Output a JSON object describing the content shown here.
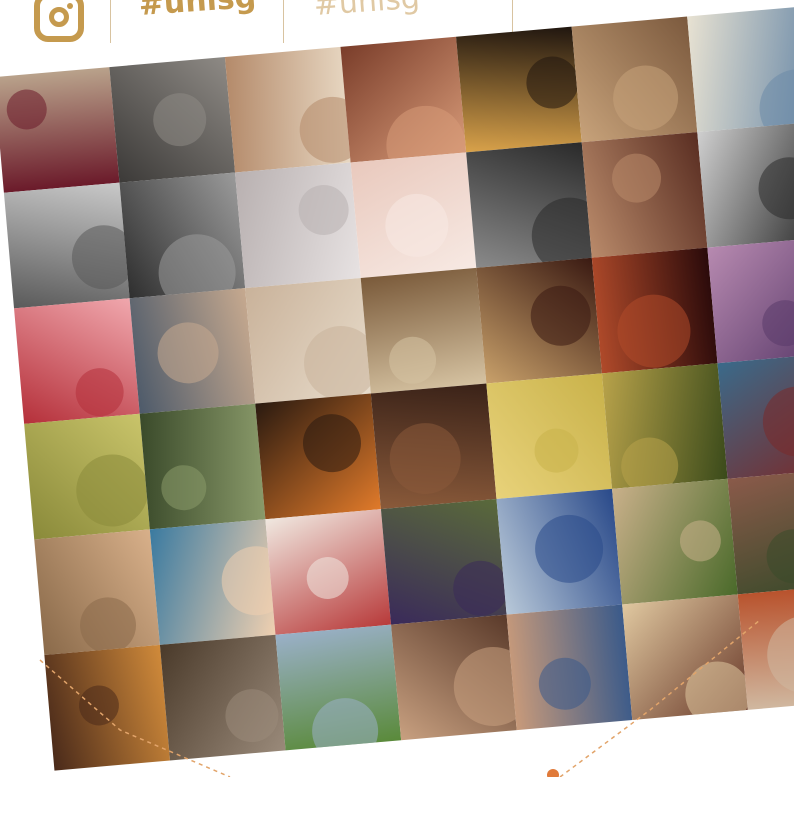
{
  "header": {
    "icon": "instagram-icon",
    "hashtag_primary": "#unisg",
    "hashtag_secondary": "#unisg",
    "accent_color": "#c59a4e"
  },
  "photos": [
    {
      "c1": "#6b1a2a",
      "c2": "#b9a28b"
    },
    {
      "c1": "#3c3a38",
      "c2": "#8e8a85"
    },
    {
      "c1": "#b48a6a",
      "c2": "#e8d8c3"
    },
    {
      "c1": "#7a3d2a",
      "c2": "#d79a78"
    },
    {
      "c1": "#20160f",
      "c2": "#d9a24a"
    },
    {
      "c1": "#7c5a3e",
      "c2": "#c7a27a"
    },
    {
      "c1": "#6b8aa8",
      "c2": "#e8e2d2"
    },
    {
      "c1": "#8a8a8a",
      "c2": "#d0d0d0"
    },
    {
      "c1": "#5a5a5a",
      "c2": "#c9c9c9"
    },
    {
      "c1": "#2f2f2f",
      "c2": "#9a9a9a"
    },
    {
      "c1": "#b8b0b0",
      "c2": "#e7e2e2"
    },
    {
      "c1": "#e9c9bd",
      "c2": "#f7e9e3"
    },
    {
      "c1": "#2a2a2a",
      "c2": "#8a8a8a"
    },
    {
      "c1": "#5a2e22",
      "c2": "#b98a6a"
    },
    {
      "c1": "#2b2b2b",
      "c2": "#cfcfcf"
    },
    {
      "c1": "#c9a070",
      "c2": "#e9d7bd"
    },
    {
      "c1": "#b5303a",
      "c2": "#f0a7ad"
    },
    {
      "c1": "#4d5a6a",
      "c2": "#c6a98f"
    },
    {
      "c1": "#c9b29a",
      "c2": "#e8dccb"
    },
    {
      "c1": "#7a5a3a",
      "c2": "#d6c3a2"
    },
    {
      "c1": "#3a1a12",
      "c2": "#c8a06a"
    },
    {
      "c1": "#2a0a0a",
      "c2": "#b04a2a"
    },
    {
      "c1": "#5a3a6a",
      "c2": "#b78ab0"
    },
    {
      "c1": "#3a2a1a",
      "c2": "#c87a3a"
    },
    {
      "c1": "#8a8a3a",
      "c2": "#c9c46a"
    },
    {
      "c1": "#3a4a2a",
      "c2": "#8a9a6a"
    },
    {
      "c1": "#2a1a10",
      "c2": "#e07a2a"
    },
    {
      "c1": "#3a2218",
      "c2": "#8a5a3a"
    },
    {
      "c1": "#c9b24a",
      "c2": "#e8d27a"
    },
    {
      "c1": "#3a4a1a",
      "c2": "#b8a24a"
    },
    {
      "c1": "#7a2a2a",
      "c2": "#3a6a8a"
    },
    {
      "c1": "#c9a24a",
      "c2": "#f0d07a"
    },
    {
      "c1": "#8a6a4a",
      "c2": "#d8b08a"
    },
    {
      "c1": "#3a7aa0",
      "c2": "#f0d0b0"
    },
    {
      "c1": "#f0e8e0",
      "c2": "#b83a3a"
    },
    {
      "c1": "#5a6a3a",
      "c2": "#3a2a5a"
    },
    {
      "c1": "#2a4a8a",
      "c2": "#b8c8d8"
    },
    {
      "c1": "#4a6a2a",
      "c2": "#c9b08a"
    },
    {
      "c1": "#3a4a2a",
      "c2": "#8a5a4a"
    },
    {
      "c1": "#6a5a4a",
      "c2": "#c8b8a0"
    },
    {
      "c1": "#4a2a1a",
      "c2": "#d08a3a"
    },
    {
      "c1": "#4a3a2a",
      "c2": "#9a8a7a"
    },
    {
      "c1": "#9ab0c8",
      "c2": "#5a8a3a"
    },
    {
      "c1": "#5a3a2a",
      "c2": "#c8a080"
    },
    {
      "c1": "#3a5a8a",
      "c2": "#c89a7a"
    },
    {
      "c1": "#6a3a2a",
      "c2": "#e0c8a0"
    },
    {
      "c1": "#d0b8a0",
      "c2": "#b8502a"
    },
    {
      "c1": "#3a4a5a",
      "c2": "#8aa0a8"
    }
  ]
}
